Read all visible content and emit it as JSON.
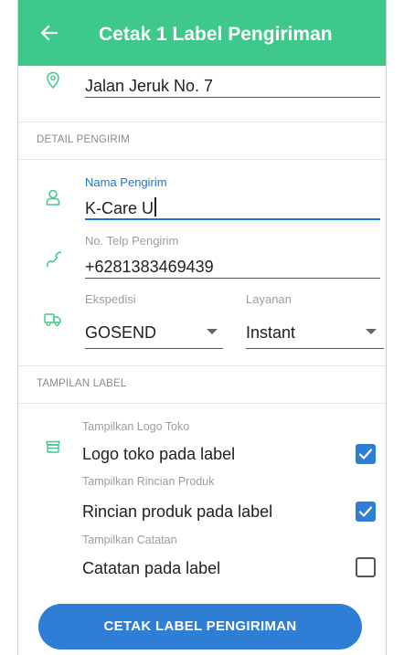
{
  "appbar": {
    "title": "Cetak 1 Label Pengiriman"
  },
  "address": {
    "value": "Jalan Jeruk No. 7"
  },
  "sender_section": {
    "title": "DETAIL PENGIRIM"
  },
  "sender_name": {
    "label": "Nama Pengirim",
    "value": "K-Care U"
  },
  "sender_phone": {
    "label": "No. Telp Pengirim",
    "value": "+6281383469439"
  },
  "expedition": {
    "label": "Ekspedisi",
    "value": "GOSEND"
  },
  "service": {
    "label": "Layanan",
    "value": "Instant"
  },
  "label_section": {
    "title": "TAMPILAN LABEL"
  },
  "options": [
    {
      "caption": "Tampilkan Logo Toko",
      "label": "Logo toko pada label",
      "checked": true
    },
    {
      "caption": "Tampilkan Rincian Produk",
      "label": "Rincian produk pada label",
      "checked": true
    },
    {
      "caption": "Tampilkan Catatan",
      "label": "Catatan pada label",
      "checked": false
    }
  ],
  "print_button": {
    "label": "CETAK LABEL PENGIRIMAN"
  },
  "colors": {
    "appbar": "#3ec98a",
    "primary": "#2f7ed6",
    "icon": "#3ec98a"
  }
}
